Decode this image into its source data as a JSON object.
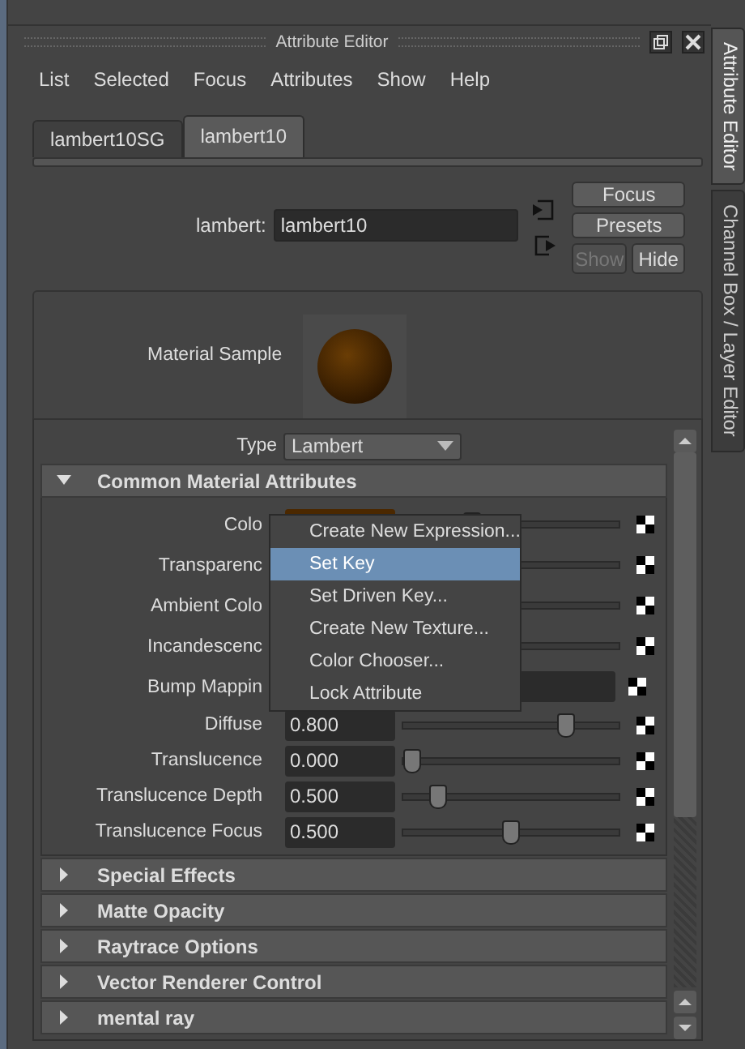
{
  "window": {
    "title": "Attribute Editor"
  },
  "menu": [
    "List",
    "Selected",
    "Focus",
    "Attributes",
    "Show",
    "Help"
  ],
  "tabs": [
    {
      "label": "lambert10SG",
      "selected": false
    },
    {
      "label": "lambert10",
      "selected": true
    }
  ],
  "node": {
    "label": "lambert:",
    "value": "lambert10"
  },
  "buttons": [
    {
      "label": "Focus",
      "disabled": false
    },
    {
      "label": "Presets",
      "disabled": false
    },
    {
      "label": "Show",
      "disabled": true
    },
    {
      "label": "Hide",
      "disabled": false
    }
  ],
  "material_sample": {
    "label": "Material Sample"
  },
  "type": {
    "label": "Type",
    "value": "Lambert"
  },
  "common_section": {
    "title": "Common Material Attributes",
    "expanded": true
  },
  "attributes": [
    {
      "label": "Colo",
      "kind": "color",
      "color": "#4b2800",
      "level": 0.3
    },
    {
      "label": "Transparenc",
      "kind": "color"
    },
    {
      "label": "Ambient Colo",
      "kind": "color"
    },
    {
      "label": "Incandescenc",
      "kind": "color"
    },
    {
      "label": "Bump Mappin",
      "kind": "map"
    },
    {
      "label": "Diffuse",
      "kind": "number",
      "value": "0.800",
      "level": 0.77
    },
    {
      "label": "Translucence",
      "kind": "number",
      "value": "0.000",
      "level": 0
    },
    {
      "label": "Translucence Depth",
      "kind": "number",
      "value": "0.500",
      "level": 0.13
    },
    {
      "label": "Translucence Focus",
      "kind": "number",
      "value": "0.500",
      "level": 0.49
    }
  ],
  "sections": [
    {
      "title": "Special Effects",
      "expanded": false
    },
    {
      "title": "Matte Opacity",
      "expanded": false
    },
    {
      "title": "Raytrace Options",
      "expanded": false
    },
    {
      "title": "Vector Renderer Control",
      "expanded": false
    },
    {
      "title": "mental ray",
      "expanded": false
    }
  ],
  "context_menu": [
    {
      "label": "Create New Expression...",
      "selected": false
    },
    {
      "label": "Set Key",
      "selected": true
    },
    {
      "label": "Set Driven Key...",
      "selected": false
    },
    {
      "label": "Create New Texture...",
      "selected": false
    },
    {
      "label": "Color Chooser...",
      "selected": false
    },
    {
      "label": "Lock Attribute",
      "selected": false
    }
  ],
  "side_tabs": [
    {
      "label": "Attribute Editor",
      "selected": true
    },
    {
      "label": "Channel Box / Layer Editor",
      "selected": false
    }
  ]
}
